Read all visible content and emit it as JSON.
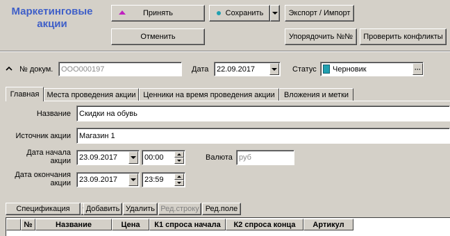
{
  "header": {
    "title_line1": "Маркетинговые",
    "title_line2": "акции"
  },
  "toolbar": {
    "accept_label": "Принять",
    "save_label": "Сохранить",
    "export_label": "Экспорт / Импорт",
    "cancel_label": "Отменить",
    "order_label": "Упорядочить №№",
    "check_label": "Проверить конфликты"
  },
  "doc": {
    "number_label": "№ докум.",
    "number_value": "ООО000197",
    "date_label": "Дата",
    "date_value": "22.09.2017",
    "status_label": "Статус",
    "status_value": "Черновик"
  },
  "tabs": [
    {
      "label": "Главная"
    },
    {
      "label": "Места проведения акции"
    },
    {
      "label": "Ценники на время проведения акции"
    },
    {
      "label": "Вложения и метки"
    }
  ],
  "form": {
    "name_label": "Название",
    "name_value": "Скидки на обувь",
    "source_label": "Источник акции",
    "source_value": "Магазин 1",
    "start_label_1": "Дата начала",
    "start_label_2": "акции",
    "start_date": "23.09.2017",
    "start_time": "00:00",
    "currency_label": "Валюта",
    "currency_value": "руб",
    "end_label_1": "Дата окончания",
    "end_label_2": "акции",
    "end_date": "23.09.2017",
    "end_time": "23:59"
  },
  "spec_toolbar": {
    "spec_label": "Спецификация",
    "add_label": "Добавить",
    "delete_label": "Удалить",
    "edit_row_label": "Ред.строку",
    "edit_field_label": "Ред.поле"
  },
  "grid": {
    "columns": [
      "№",
      "Название",
      "Цена",
      "К1 спроса начала",
      "К2 спроса конца",
      "Артикул"
    ]
  },
  "colors": {
    "title": "#3f5fc8",
    "accent_magenta": "#c020c0",
    "status_icon": "#20a0b0"
  }
}
